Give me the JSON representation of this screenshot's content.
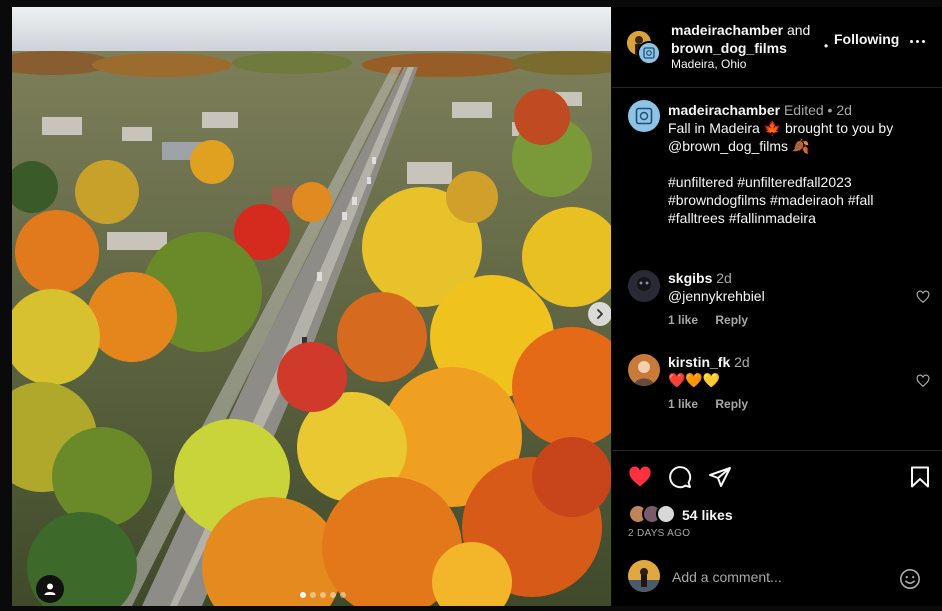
{
  "post": {
    "author": "madeirachamber",
    "collab_joiner": "and",
    "collaborator": "brown_dog_films",
    "location": "Madeira, Ohio",
    "follow_dot": "•",
    "follow_status": "Following",
    "carousel": {
      "current": 1,
      "total": 5
    }
  },
  "caption": {
    "username": "madeirachamber",
    "edited": "Edited",
    "sep": "•",
    "time": "2d",
    "line1": "Fall in Madeira 🍁 brought to you by",
    "mention": "@brown_dog_films",
    "mention_emoji": "🍂",
    "hashtags": "#unfiltered #unfilteredfall2023 #browndogfilms #madeiraoh #fall #falltrees #fallinmadeira"
  },
  "comments": [
    {
      "username": "skgibs",
      "time": "2d",
      "text": "@jennykrehbiel",
      "likes": "1 like",
      "reply": "Reply"
    },
    {
      "username": "kirstin_fk",
      "time": "2d",
      "text": "❤️🧡💛",
      "likes": "1 like",
      "reply": "Reply"
    }
  ],
  "engagement": {
    "likes": "54 likes",
    "posted": "2 DAYS AGO",
    "liked_color": "#ff3040"
  },
  "add_comment": {
    "placeholder": "Add a comment..."
  },
  "icons": {
    "more": "more-options-icon",
    "like": "heart-filled-icon",
    "comment": "comment-bubble-icon",
    "share": "paper-plane-icon",
    "save": "bookmark-icon",
    "emoji": "smiley-icon",
    "next": "chevron-right-icon",
    "tag": "user-tag-icon"
  }
}
